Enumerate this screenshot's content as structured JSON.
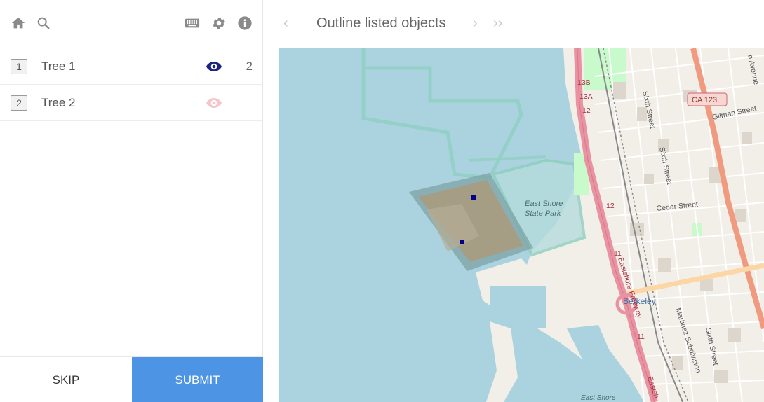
{
  "toolbar": {
    "home_icon": "home-icon",
    "search_icon": "search-icon",
    "keyboard_icon": "keyboard-icon",
    "settings_icon": "gear-icon",
    "info_icon": "info-icon"
  },
  "objects": [
    {
      "index": "1",
      "label": "Tree 1",
      "visible": true,
      "count": "2"
    },
    {
      "index": "2",
      "label": "Tree 2",
      "visible": false,
      "count": ""
    }
  ],
  "actions": {
    "skip_label": "SKIP",
    "submit_label": "SUBMIT"
  },
  "task": {
    "title": "Outline listed objects",
    "prev_arrow": "‹",
    "next_arrow": "›",
    "last_arrow": "››"
  },
  "map": {
    "labels": {
      "park": "East Shore",
      "park2": "State Park",
      "berkeley": "Berkeley",
      "ca123": "CA 123",
      "sixth": "Sixth Street",
      "sixth2": "Sixth Street",
      "sixth3": "Sixth Street",
      "cedar": "Cedar Street",
      "gilman": "Gilman Street",
      "eastshore": "Eastshore Freeway",
      "martinez": "Martinez Subdivision",
      "exit13b": "13B",
      "exit13a": "13A",
      "exit12": "12",
      "exit12b": "12",
      "exit11": "11",
      "exit11b": "11",
      "avenue": "n Avenue",
      "east2": "Eastsh",
      "eastshore_bottom": "East Shore"
    },
    "colors": {
      "water": "#aad3df",
      "land": "#f2efe9",
      "park": "#c8facc",
      "freeway": "#e892a2",
      "primary": "#fcd6a4",
      "marker": "#00008b"
    }
  },
  "colors": {
    "accent": "#4d94e5",
    "eye_on": "#1a237e",
    "eye_off": "#f3c7cc"
  }
}
